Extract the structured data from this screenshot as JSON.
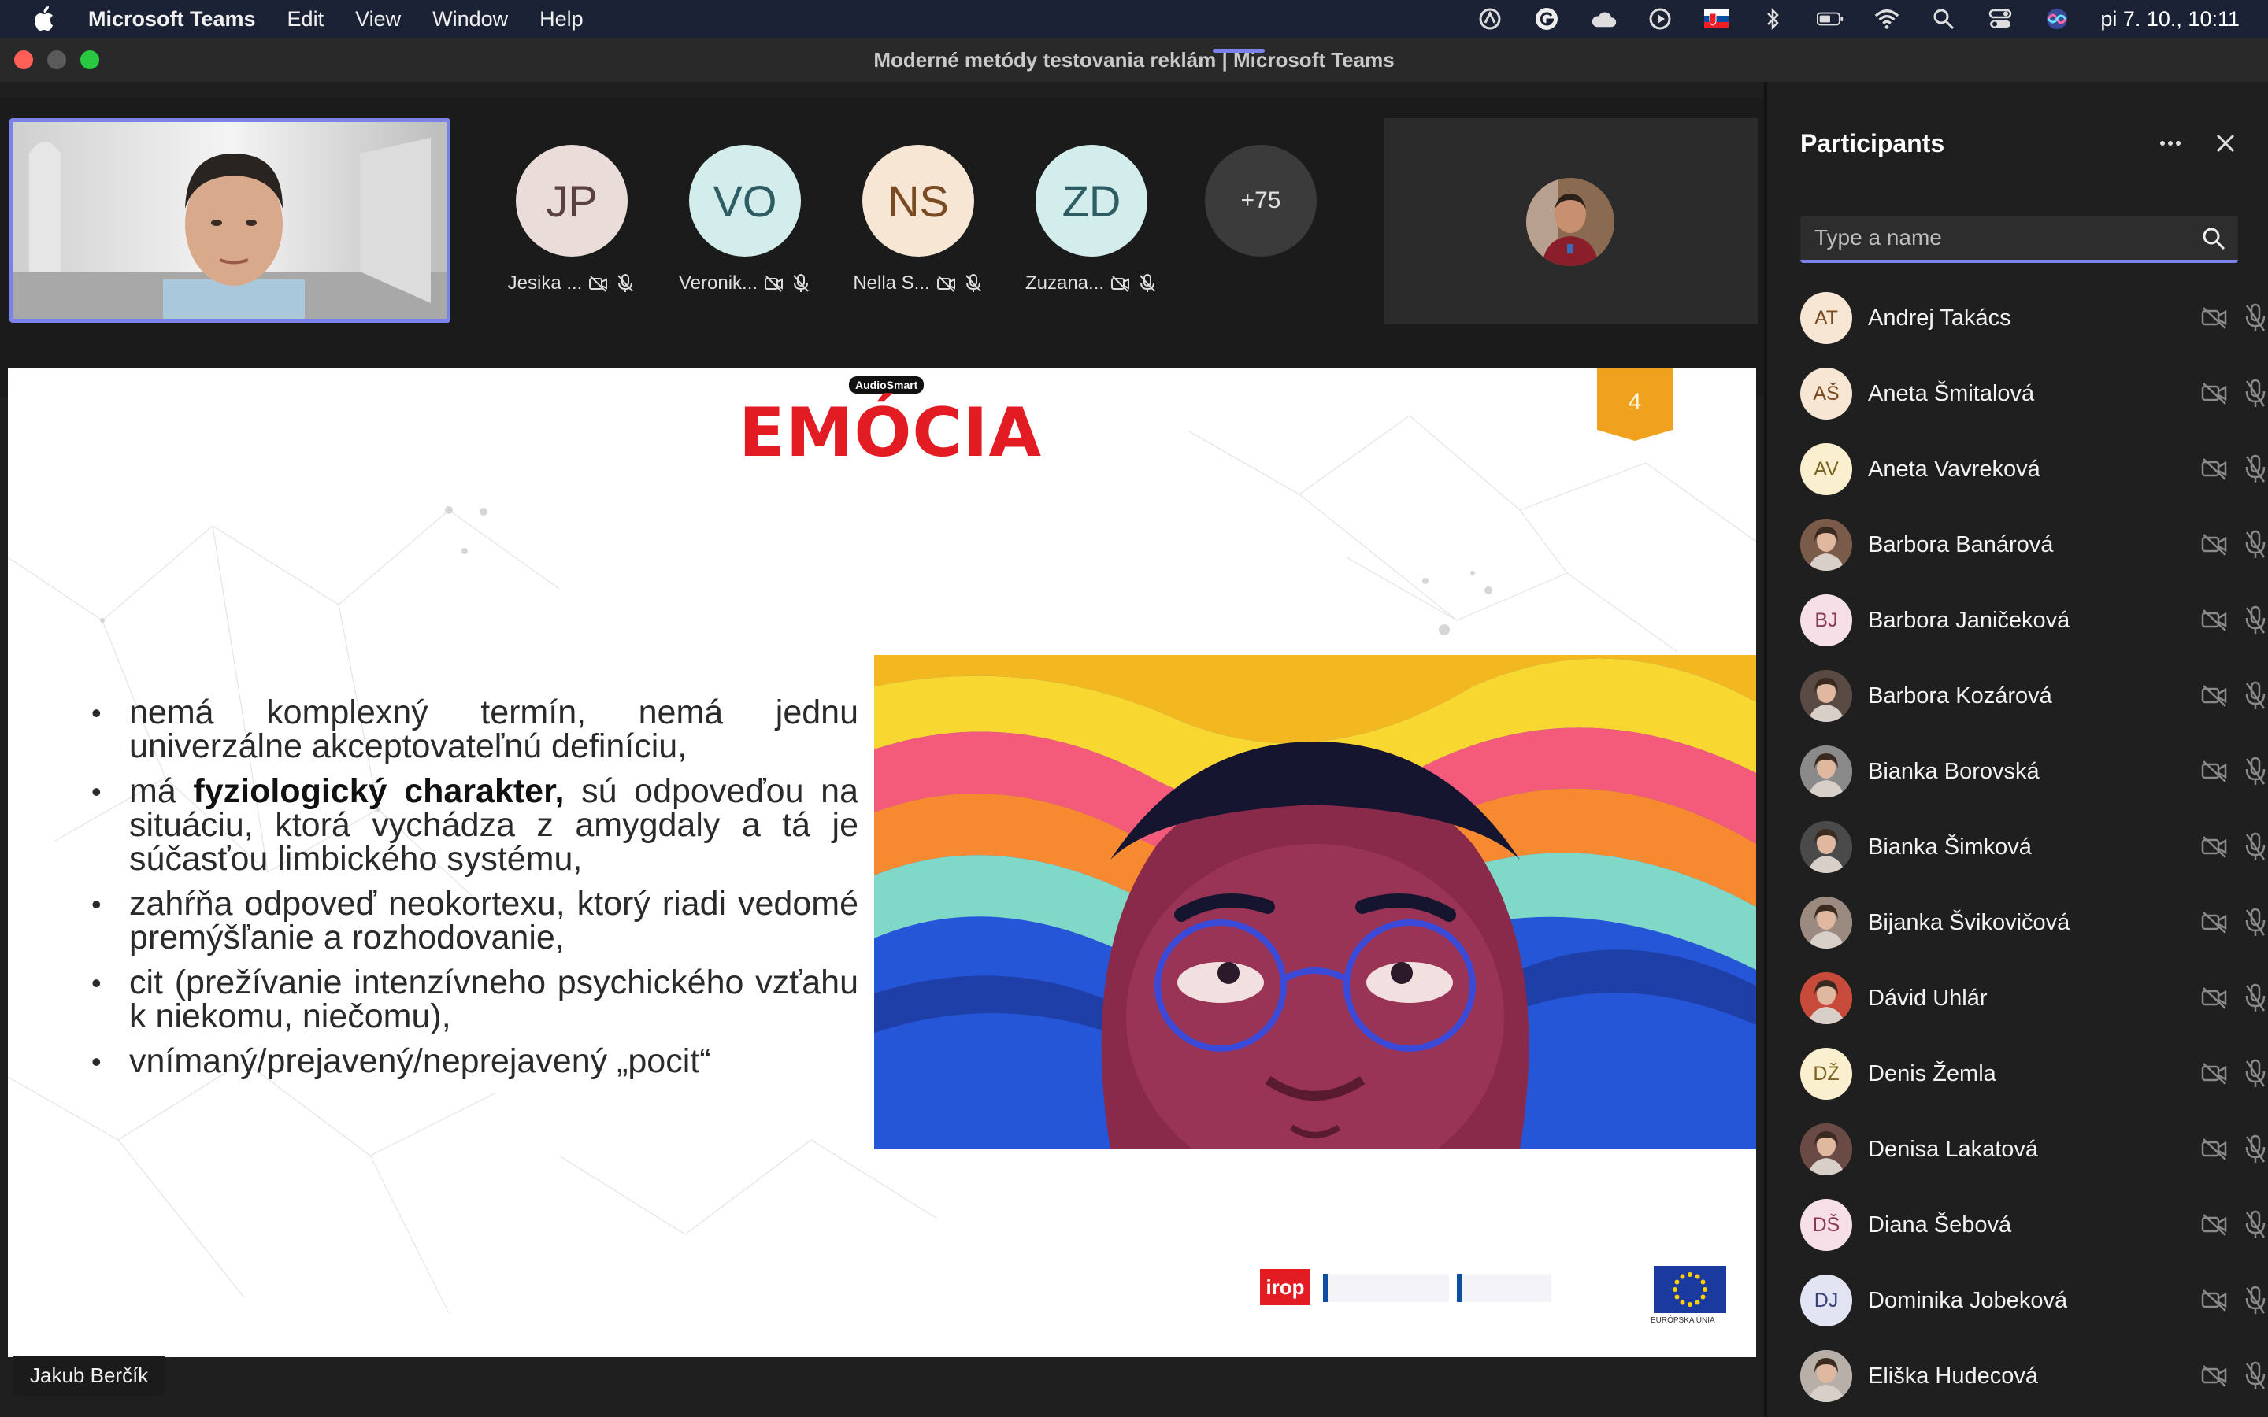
{
  "menubar": {
    "app_name": "Microsoft Teams",
    "menus": [
      "Edit",
      "View",
      "Window",
      "Help"
    ],
    "clock": "pi 7. 10.,  10:11"
  },
  "window": {
    "title": "Moderné metódy testovania reklám | Microsoft Teams"
  },
  "video_strip": {
    "tiles": [
      {
        "initials": "JP",
        "name": "Jesika ...",
        "bg": "#eadcd8",
        "fg": "#5a4040"
      },
      {
        "initials": "VO",
        "name": "Veronik...",
        "bg": "#d3ecec",
        "fg": "#2e5c63"
      },
      {
        "initials": "NS",
        "name": "Nella S...",
        "bg": "#f8e6d4",
        "fg": "#7a4a22"
      },
      {
        "initials": "ZD",
        "name": "Zuzana...",
        "bg": "#d3ecec",
        "fg": "#2e5c63"
      }
    ],
    "overflow_count": "+75"
  },
  "slide": {
    "brand": "AudioSmart",
    "title": "EMÓCIA",
    "page_number": "4",
    "bullets": [
      {
        "pre": "nemá komplexný termín, nemá jednu univerzálne akceptovateľnú definíciu,",
        "bold": "",
        "post": ""
      },
      {
        "pre": "má ",
        "bold": "fyziologický charakter,",
        "post": " sú odpoveďou na situáciu, ktorá vychádza z amygdaly a tá je súčasťou limbického systému,"
      },
      {
        "pre": "zahŕňa odpoveď neokortexu, ktorý riadi vedomé premýšľanie a rozhodovanie,",
        "bold": "",
        "post": ""
      },
      {
        "pre": "cit (prežívanie intenzívneho psychického vzťahu k niekomu, niečomu),",
        "bold": "",
        "post": ""
      },
      {
        "pre": "vnímaný/prejavený/neprejavený „pocit“",
        "bold": "",
        "post": ""
      }
    ],
    "logo_irop": "irop",
    "logo_eu": "EURÓPSKA ÚNIA"
  },
  "speaker": {
    "name": "Jakub Berčík"
  },
  "participants": {
    "title": "Participants",
    "search_placeholder": "Type a name",
    "list": [
      {
        "initials": "AT",
        "name": "Andrej Takács",
        "bg": "#f8e6d4",
        "fg": "#7a4a22",
        "photo": false
      },
      {
        "initials": "AŠ",
        "name": "Aneta Šmitalová",
        "bg": "#f8e6d4",
        "fg": "#7a4a22",
        "photo": false
      },
      {
        "initials": "AV",
        "name": "Aneta Vavreková",
        "bg": "#faf0d0",
        "fg": "#7a6220",
        "photo": false
      },
      {
        "initials": "",
        "name": "Barbora Banárová",
        "bg": "#7a5a48",
        "fg": "#fff",
        "photo": true
      },
      {
        "initials": "BJ",
        "name": "Barbora Janičeková",
        "bg": "#f6dfe6",
        "fg": "#8a3a52",
        "photo": false
      },
      {
        "initials": "",
        "name": "Barbora Kozárová",
        "bg": "#5a4a44",
        "fg": "#fff",
        "photo": true
      },
      {
        "initials": "",
        "name": "Bianka Borovská",
        "bg": "#8a8a8a",
        "fg": "#fff",
        "photo": true
      },
      {
        "initials": "",
        "name": "Bianka Šimková",
        "bg": "#4a4a4a",
        "fg": "#fff",
        "photo": true
      },
      {
        "initials": "",
        "name": "Bijanka Švikovičová",
        "bg": "#9a8a80",
        "fg": "#fff",
        "photo": true
      },
      {
        "initials": "",
        "name": "Dávid Uhlár",
        "bg": "#c84a3a",
        "fg": "#fff",
        "photo": true
      },
      {
        "initials": "DŽ",
        "name": "Denis Žemla",
        "bg": "#faf0d0",
        "fg": "#7a6220",
        "photo": false
      },
      {
        "initials": "",
        "name": "Denisa Lakatová",
        "bg": "#6a4a44",
        "fg": "#fff",
        "photo": true
      },
      {
        "initials": "DŠ",
        "name": "Diana Šebová",
        "bg": "#f6dfe6",
        "fg": "#8a3a52",
        "photo": false
      },
      {
        "initials": "DJ",
        "name": "Dominika Jobeková",
        "bg": "#e2e4f4",
        "fg": "#3a4078",
        "photo": false
      },
      {
        "initials": "",
        "name": "Eliška Hudecová",
        "bg": "#b8b0a8",
        "fg": "#fff",
        "photo": true
      }
    ]
  },
  "colors": {
    "accent": "#7b83eb",
    "slide_title": "#e31b23",
    "page_badge": "#f0a21e"
  }
}
